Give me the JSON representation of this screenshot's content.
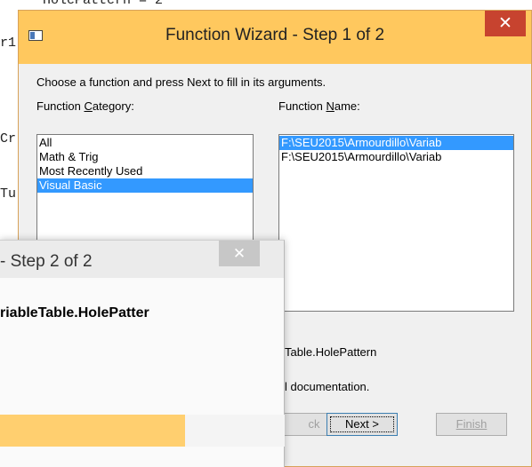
{
  "background_code": [
    "HolePattern = 2",
    "r1",
    "Cr",
    "Tu"
  ],
  "step1": {
    "title": "Function Wizard - Step 1 of 2",
    "close": "✕",
    "instruction": "Choose a function and press Next to fill in its arguments.",
    "category_label_pre": "Function ",
    "category_label_u": "C",
    "category_label_post": "ategory:",
    "name_label_pre": "Function ",
    "name_label_u": "N",
    "name_label_post": "ame:",
    "categories": [
      "All",
      "Math & Trig",
      "Most Recently Used",
      "Visual Basic"
    ],
    "selected_category": "Visual Basic",
    "functions": [
      "F:\\SEU2015\\Armourdillo\\Variab",
      "F:\\SEU2015\\Armourdillo\\Variab"
    ],
    "desc_line1": "Table.HolePattern",
    "desc_line2": "l documentation.",
    "back_label": "ck",
    "next_label": "Next >",
    "finish_label": "Finish"
  },
  "step2": {
    "title": "- Step 2 of 2",
    "close": "✕",
    "function_name": "riableTable.HolePatter"
  },
  "colors": {
    "accent": "#ffc85e",
    "close": "#c7432f",
    "selection": "#3399ff"
  }
}
